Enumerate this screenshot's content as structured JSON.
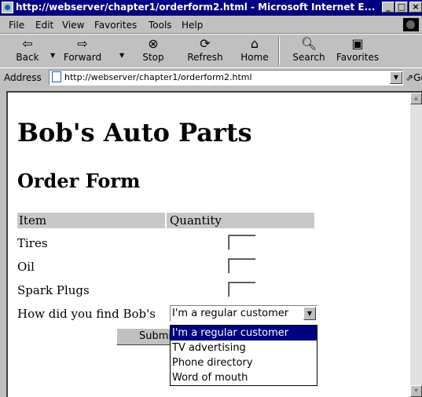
{
  "window": {
    "title": "http://webserver/chapter1/orderform2.html - Microsoft Internet E...",
    "controls": [
      "_",
      "□",
      "×"
    ]
  },
  "menu": [
    "File",
    "Edit",
    "View",
    "Favorites",
    "Tools",
    "Help"
  ],
  "toolbar": {
    "back": "Back",
    "forward": "Forward",
    "stop": "Stop",
    "refresh": "Refresh",
    "home": "Home",
    "search": "Search",
    "favorites": "Favorites"
  },
  "address": {
    "label": "Address",
    "url": "http://webserver/chapter1/orderform2.html",
    "go": "Go"
  },
  "page": {
    "heading": "Bob's Auto Parts",
    "subheading": "Order Form",
    "table": {
      "col_item": "Item",
      "col_quantity": "Quantity",
      "rows": [
        "Tires",
        "Oil",
        "Spark Plugs"
      ]
    },
    "find_label": "How did you find Bob's",
    "find_selected": "I'm a regular customer",
    "find_options": [
      "I'm a regular customer",
      "TV advertising",
      "Phone directory",
      "Word of mouth"
    ],
    "submit": "Submit Order"
  }
}
